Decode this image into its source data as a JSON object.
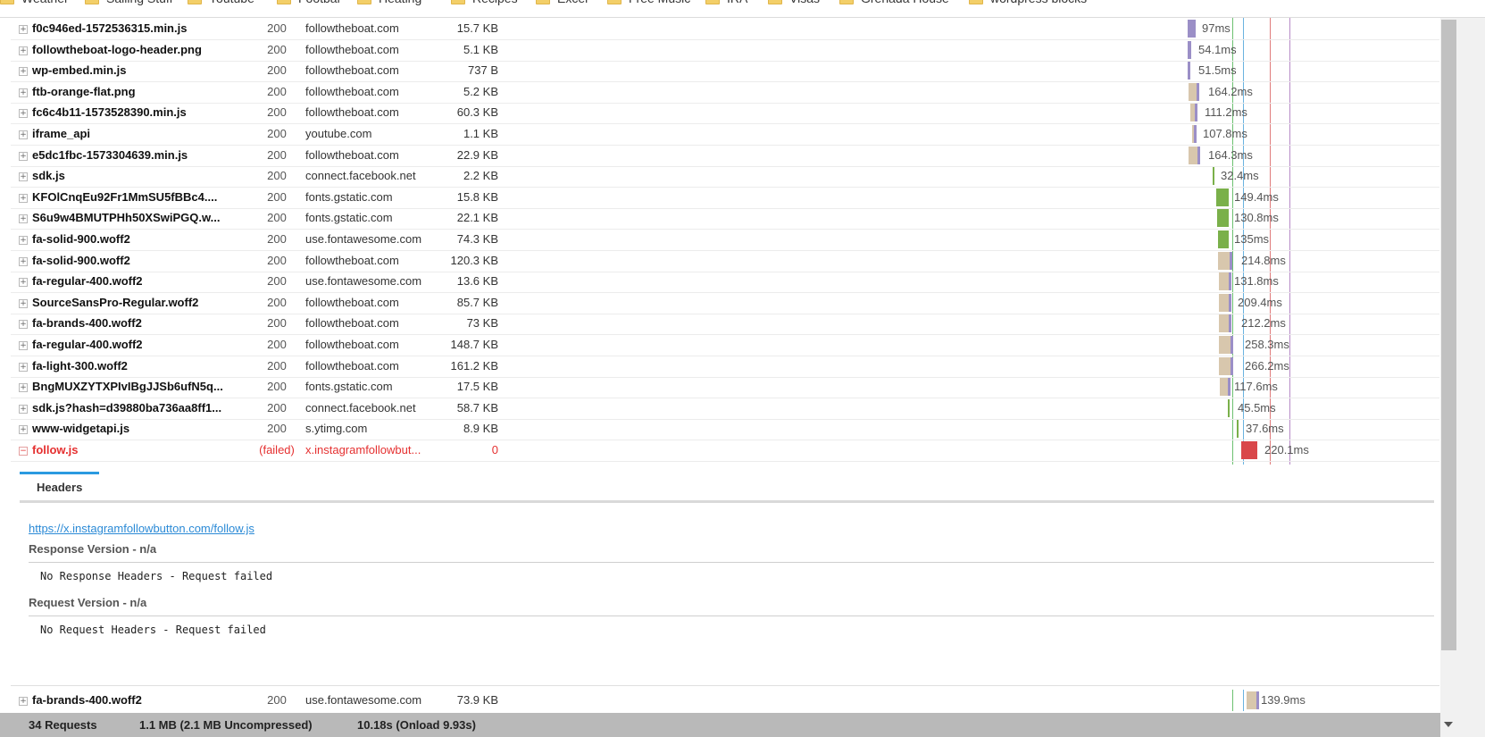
{
  "bookmarks": [
    {
      "label": "Weather"
    },
    {
      "label": "Sailing Stuff"
    },
    {
      "label": "Youtube"
    },
    {
      "label": "Footbal"
    },
    {
      "label": "Heating"
    },
    {
      "label": "Recipes"
    },
    {
      "label": "Excel"
    },
    {
      "label": "Free Music"
    },
    {
      "label": "IRA"
    },
    {
      "label": "Visas"
    },
    {
      "label": "Grenada House"
    },
    {
      "label": "wordpress blocks"
    }
  ],
  "requests": [
    {
      "name": "f0c946ed-1572536315.min.js",
      "status": "200",
      "domain": "followtheboat.com",
      "size": "15.7 KB",
      "time": "97ms"
    },
    {
      "name": "followtheboat-logo-header.png",
      "status": "200",
      "domain": "followtheboat.com",
      "size": "5.1 KB",
      "time": "54.1ms"
    },
    {
      "name": "wp-embed.min.js",
      "status": "200",
      "domain": "followtheboat.com",
      "size": "737 B",
      "time": "51.5ms"
    },
    {
      "name": "ftb-orange-flat.png",
      "status": "200",
      "domain": "followtheboat.com",
      "size": "5.2 KB",
      "time": "164.2ms"
    },
    {
      "name": "fc6c4b11-1573528390.min.js",
      "status": "200",
      "domain": "followtheboat.com",
      "size": "60.3 KB",
      "time": "111.2ms"
    },
    {
      "name": "iframe_api",
      "status": "200",
      "domain": "youtube.com",
      "size": "1.1 KB",
      "time": "107.8ms"
    },
    {
      "name": "e5dc1fbc-1573304639.min.js",
      "status": "200",
      "domain": "followtheboat.com",
      "size": "22.9 KB",
      "time": "164.3ms"
    },
    {
      "name": "sdk.js",
      "status": "200",
      "domain": "connect.facebook.net",
      "size": "2.2 KB",
      "time": "32.4ms"
    },
    {
      "name": "KFOlCnqEu92Fr1MmSU5fBBc4....",
      "status": "200",
      "domain": "fonts.gstatic.com",
      "size": "15.8 KB",
      "time": "149.4ms"
    },
    {
      "name": "S6u9w4BMUTPHh50XSwiPGQ.w...",
      "status": "200",
      "domain": "fonts.gstatic.com",
      "size": "22.1 KB",
      "time": "130.8ms"
    },
    {
      "name": "fa-solid-900.woff2",
      "status": "200",
      "domain": "use.fontawesome.com",
      "size": "74.3 KB",
      "time": "135ms"
    },
    {
      "name": "fa-solid-900.woff2",
      "status": "200",
      "domain": "followtheboat.com",
      "size": "120.3 KB",
      "time": "214.8ms"
    },
    {
      "name": "fa-regular-400.woff2",
      "status": "200",
      "domain": "use.fontawesome.com",
      "size": "13.6 KB",
      "time": "131.8ms"
    },
    {
      "name": "SourceSansPro-Regular.woff2",
      "status": "200",
      "domain": "followtheboat.com",
      "size": "85.7 KB",
      "time": "209.4ms"
    },
    {
      "name": "fa-brands-400.woff2",
      "status": "200",
      "domain": "followtheboat.com",
      "size": "73 KB",
      "time": "212.2ms"
    },
    {
      "name": "fa-regular-400.woff2",
      "status": "200",
      "domain": "followtheboat.com",
      "size": "148.7 KB",
      "time": "258.3ms"
    },
    {
      "name": "fa-light-300.woff2",
      "status": "200",
      "domain": "followtheboat.com",
      "size": "161.2 KB",
      "time": "266.2ms"
    },
    {
      "name": "BngMUXZYTXPIvIBgJJSb6ufN5q...",
      "status": "200",
      "domain": "fonts.gstatic.com",
      "size": "17.5 KB",
      "time": "117.6ms"
    },
    {
      "name": "sdk.js?hash=d39880ba736aa8ff1...",
      "status": "200",
      "domain": "connect.facebook.net",
      "size": "58.7 KB",
      "time": "45.5ms"
    },
    {
      "name": "www-widgetapi.js",
      "status": "200",
      "domain": "s.ytimg.com",
      "size": "8.9 KB",
      "time": "37.6ms"
    },
    {
      "name": "follow.js",
      "status": "(failed)",
      "domain": "x.instagramfollowbut...",
      "size": "0",
      "time": "220.1ms",
      "failed": true
    }
  ],
  "details": {
    "tab_label": "Headers",
    "url": "https://x.instagramfollowbutton.com/follow.js",
    "response_title": "Response Version - n/a",
    "response_text": "No Response Headers - Request failed",
    "request_title": "Request Version - n/a",
    "request_text": "No Request Headers - Request failed"
  },
  "after_row": {
    "name": "fa-brands-400.woff2",
    "status": "200",
    "domain": "use.fontawesome.com",
    "size": "73.9 KB",
    "time": "139.9ms"
  },
  "footer": {
    "requests": "34 Requests",
    "transfer": "1.1 MB  (2.1 MB Uncompressed)",
    "timing": "10.18s  (Onload 9.93s)"
  },
  "colors": {
    "wait": "#d8c7ad",
    "receive": "#9b8fc7",
    "green_line": "#6cc070",
    "blue_line": "#6ab3e0",
    "red_line": "#e07b7b",
    "purple_line": "#b78ac7",
    "failed": "#e53030",
    "failed_bar": "#d9474a",
    "link": "#2b8ad6"
  }
}
